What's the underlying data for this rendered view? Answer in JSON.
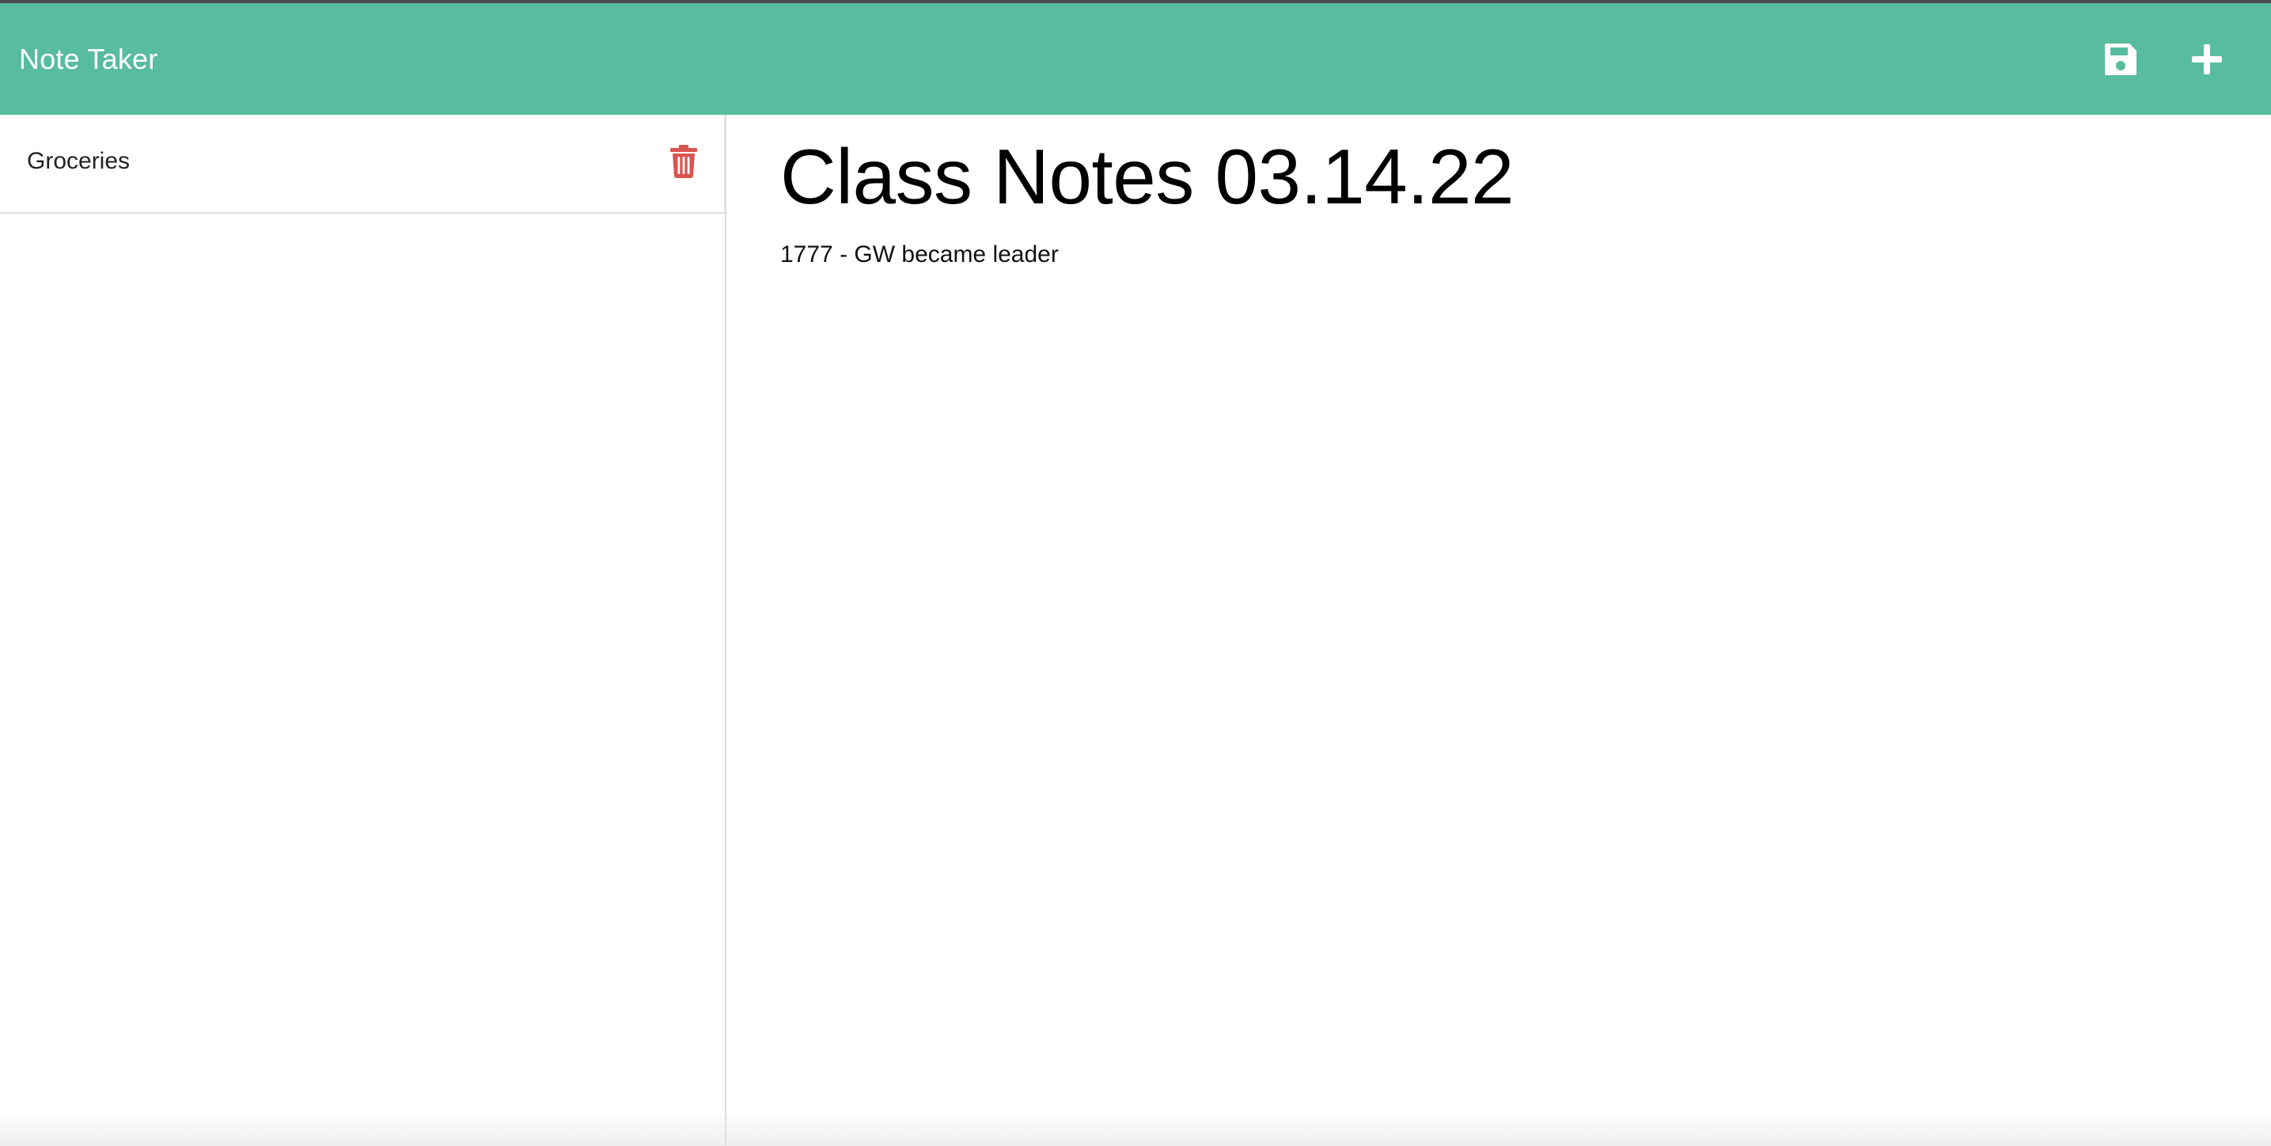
{
  "app": {
    "title": "Note Taker"
  },
  "toolbar": {
    "save_icon": "floppy-disk-icon",
    "new_icon": "plus-icon"
  },
  "sidebar": {
    "items": [
      {
        "title": "Groceries",
        "delete_icon": "trash-icon"
      }
    ]
  },
  "note": {
    "title": "Class Notes 03.14.22",
    "body": "1777 - GW became leader"
  },
  "colors": {
    "navbar": "#58bc9f",
    "delete_icon": "#d9534f",
    "icon_white": "#ffffff"
  }
}
